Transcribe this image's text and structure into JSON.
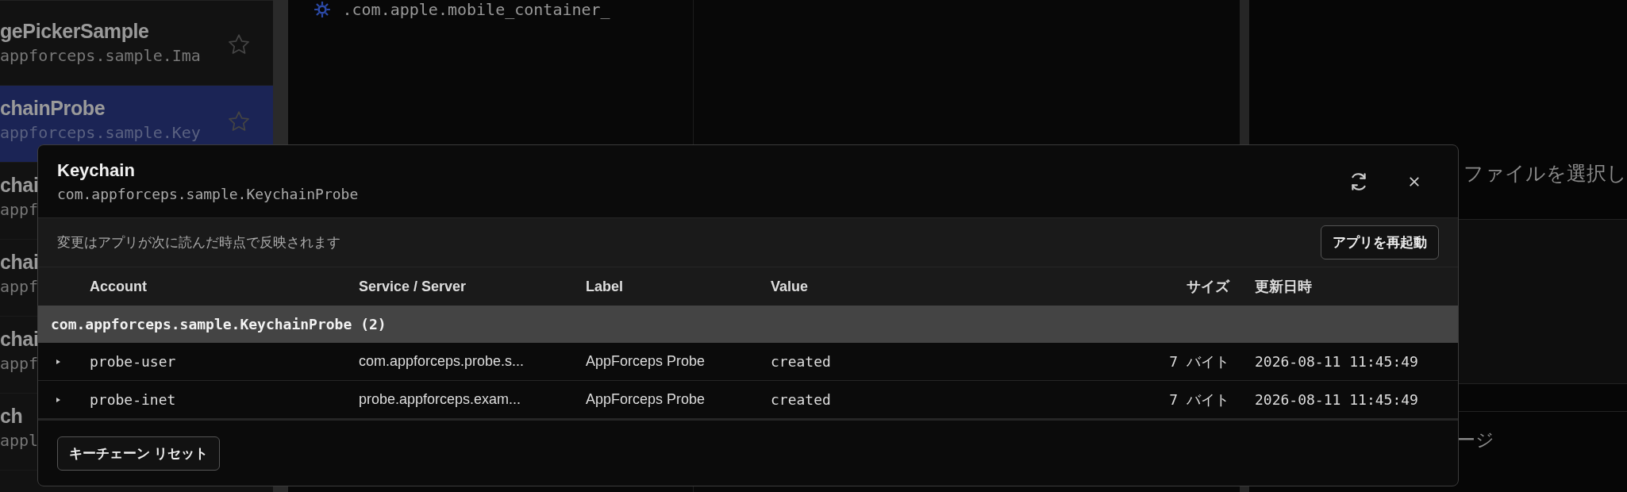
{
  "sidebar": {
    "items": [
      {
        "title": "gePickerSample",
        "subtitle": "appforceps.sample.Ima",
        "selected": false
      },
      {
        "title": "chainProbe",
        "subtitle": "appforceps.sample.Key",
        "selected": true
      },
      {
        "title": "chai",
        "subtitle": "appf",
        "selected": false
      },
      {
        "title": "chai",
        "subtitle": "appf",
        "selected": false
      },
      {
        "title": "chai",
        "subtitle": "appf",
        "selected": false
      },
      {
        "title": "ch",
        "subtitle": "appl",
        "selected": false
      }
    ]
  },
  "file_list": {
    "path": ".com.apple.mobile_container_"
  },
  "detail_pane": {
    "prompt": "ファイルを選択し",
    "section_label": "ージ"
  },
  "dialog": {
    "title": "Keychain",
    "subtitle": "com.appforceps.sample.KeychainProbe",
    "notice": "変更はアプリが次に読んだ時点で反映されます",
    "restart_button": "アプリを再起動",
    "columns": [
      {
        "label": "Account"
      },
      {
        "label": "Service / Server"
      },
      {
        "label": "Label"
      },
      {
        "label": "Value"
      },
      {
        "label": "サイズ"
      },
      {
        "label": "更新日時"
      }
    ],
    "groups": [
      {
        "label": "com.appforceps.sample.KeychainProbe (2)",
        "rows": [
          {
            "expanded": false,
            "cells": [
              "probe-user",
              "com.appforceps.probe.s...",
              "AppForceps Probe",
              "created",
              "7 バイト",
              "2026-08-11 11:45:49"
            ]
          },
          {
            "expanded": false,
            "cells": [
              "probe-inet",
              "probe.appforceps.exam...",
              "AppForceps Probe",
              "created",
              "7 バイト",
              "2026-08-11 11:45:49"
            ]
          }
        ]
      }
    ],
    "reset_button": "キーチェーン リセット"
  }
}
